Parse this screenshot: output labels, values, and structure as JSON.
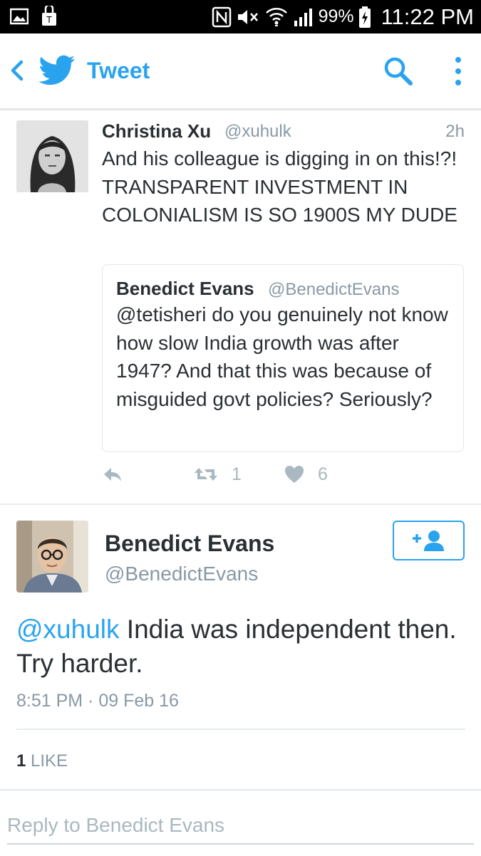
{
  "status_bar": {
    "battery_pct": "99%",
    "time": "11:22 PM"
  },
  "header": {
    "title": "Tweet"
  },
  "quoted_context": {
    "author_name": "Christina Xu",
    "author_handle": "@xuhulk",
    "time_ago": "2h",
    "text": "And his colleague is digging in on this!?! TRANSPARENT INVESTMENT IN COLONIALISM IS SO 1900S MY DUDE",
    "quote": {
      "author_name": "Benedict Evans",
      "author_handle": "@BenedictEvans",
      "text": "@tetisheri do you genuinely not know how slow India growth was after 1947? And that this was because of misguided govt policies? Seriously?"
    },
    "retweet_count": "1",
    "like_count": "6"
  },
  "tweet": {
    "author_name": "Benedict Evans",
    "author_handle": "@BenedictEvans",
    "mention": "@xuhulk",
    "text_line1": " India was independent then.",
    "text_line2": "Try harder.",
    "timestamp": "8:51 PM · 09 Feb 16",
    "like_count": "1",
    "like_label": "LIKE"
  },
  "reply": {
    "placeholder": "Reply to Benedict Evans"
  },
  "colors": {
    "accent": "#2aa3ef",
    "muted": "#8899a6",
    "text": "#292f33"
  }
}
